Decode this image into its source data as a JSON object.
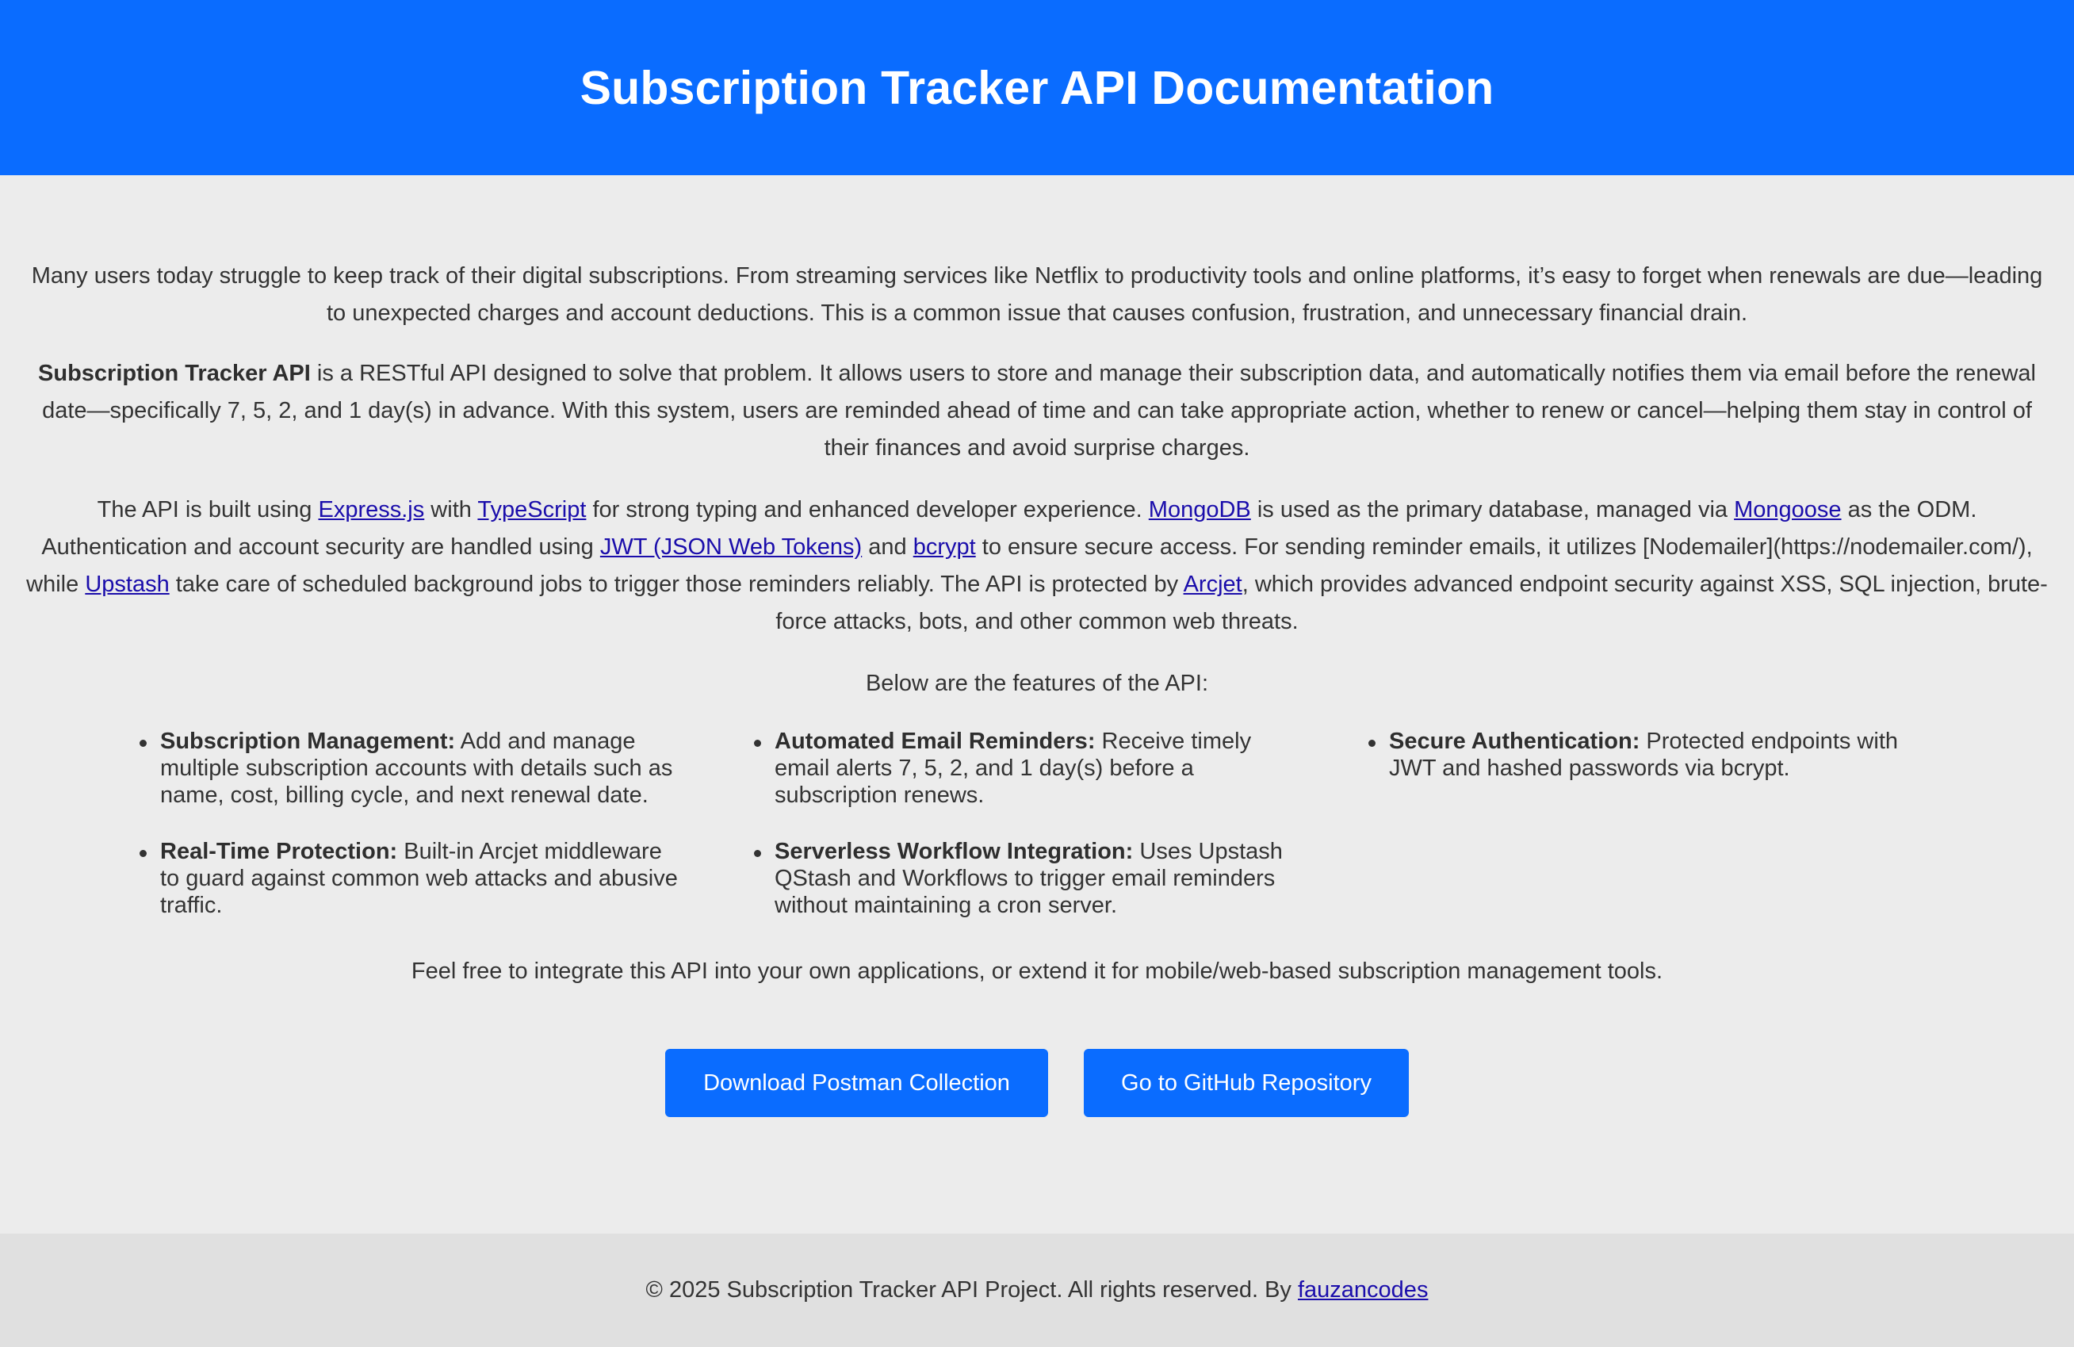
{
  "colors": {
    "header_bg": "#0a6cff",
    "page_bg": "#ececec",
    "footer_bg": "#e0e0e0",
    "button_bg": "#0a6cff",
    "link": "#1a0dab"
  },
  "header": {
    "title": "Subscription Tracker API Documentation"
  },
  "intro": {
    "p1": "Many users today struggle to keep track of their digital subscriptions. From streaming services like Netflix to productivity tools and online platforms, it’s easy to forget when renewals are due—leading to unexpected charges and account deductions. This is a common issue that causes confusion, frustration, and unnecessary financial drain.",
    "p2_strong": "Subscription Tracker API",
    "p2_rest": " is a RESTful API designed to solve that problem. It allows users to store and manage their subscription data, and automatically notifies them via email before the renewal date—specifically 7, 5, 2, and 1 day(s) in advance. With this system, users are reminded ahead of time and can take appropriate action, whether to renew or cancel—helping them stay in control of their finances and avoid surprise charges."
  },
  "tech": {
    "t1": "The API is built using ",
    "link_express": "Express.js",
    "t2": " with ",
    "link_typescript": "TypeScript",
    "t3": " for strong typing and enhanced developer experience. ",
    "link_mongodb": "MongoDB",
    "t4": " is used as the primary database, managed via ",
    "link_mongoose": "Mongoose",
    "t5": " as the ODM. Authentication and account security are handled using ",
    "link_jwt": "JWT (JSON Web Tokens)",
    "t6": " and ",
    "link_bcrypt": "bcrypt",
    "t7": " to ensure secure access. For sending reminder emails, it utilizes [Nodemailer](https://nodemailer.com/), while ",
    "link_upstash": "Upstash",
    "t8": " take care of scheduled background jobs to trigger those reminders reliably. The API is protected by ",
    "link_arcjet": "Arcjet",
    "t9": ", which provides advanced endpoint security against XSS, SQL injection, brute-force attacks, bots, and other common web threats."
  },
  "features_intro": "Below are the features of the API:",
  "features": [
    {
      "title": "Subscription Management:",
      "text": " Add and manage multiple subscription accounts with details such as name, cost, billing cycle, and next renewal date."
    },
    {
      "title": "Automated Email Reminders:",
      "text": " Receive timely email alerts 7, 5, 2, and 1 day(s) before a subscription renews."
    },
    {
      "title": "Secure Authentication:",
      "text": " Protected endpoints with JWT and hashed passwords via bcrypt."
    },
    {
      "title": "Real-Time Protection:",
      "text": " Built-in Arcjet middleware to guard against common web attacks and abusive traffic."
    },
    {
      "title": "Serverless Workflow Integration:",
      "text": " Uses Upstash QStash and Workflows to trigger email reminders without maintaining a cron server."
    }
  ],
  "outro": "Feel free to integrate this API into your own applications, or extend it for mobile/web-based subscription management tools.",
  "buttons": {
    "postman": "Download Postman Collection",
    "github": "Go to GitHub Repository"
  },
  "footer": {
    "text": "© 2025 Subscription Tracker API Project. All rights reserved. By ",
    "author_link": "fauzancodes"
  }
}
